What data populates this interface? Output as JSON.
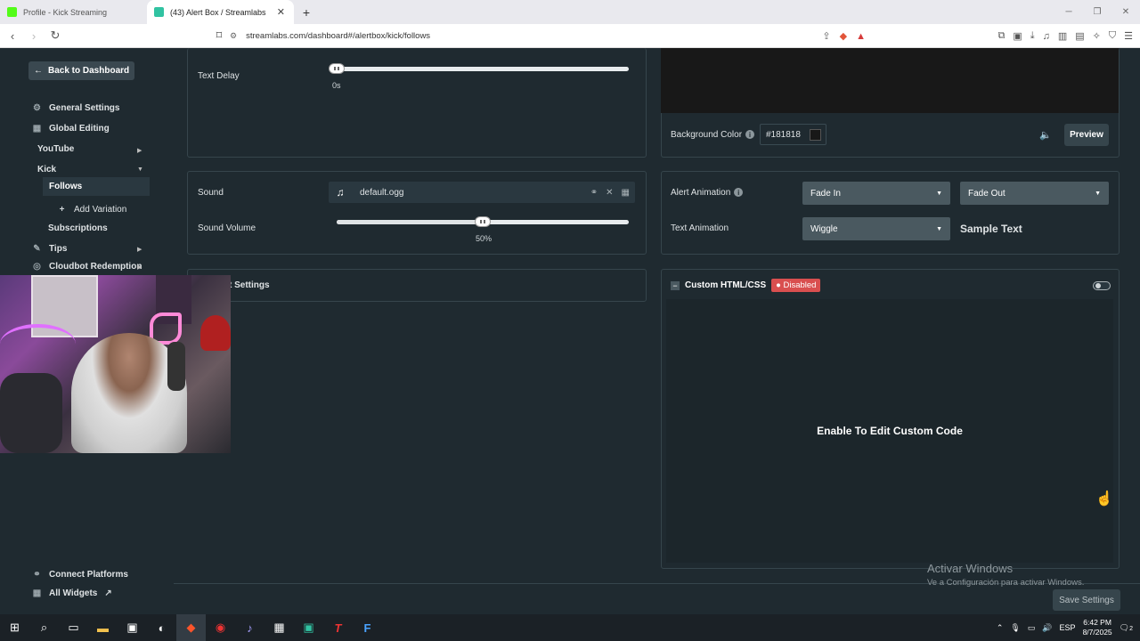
{
  "browser": {
    "tabs": [
      {
        "title": "Profile - Kick Streaming",
        "favicon_color": "#53fc18"
      },
      {
        "title": "(43) Alert Box / Streamlabs",
        "favicon_color": "#31c3a2"
      }
    ],
    "url": "streamlabs.com/dashboard#/alertbox/kick/follows"
  },
  "sidebar": {
    "back_label": "Back to Dashboard",
    "general_settings": "General Settings",
    "global_editing": "Global Editing",
    "youtube": "YouTube",
    "kick": "Kick",
    "follows": "Follows",
    "add_variation": "Add Variation",
    "subscriptions": "Subscriptions",
    "tips": "Tips",
    "cloudbot": "Cloudbot Redemption",
    "connect_platforms": "Connect Platforms",
    "all_widgets": "All Widgets"
  },
  "left_panel": {
    "text_delay_label": "Text Delay",
    "text_delay_value": "0s",
    "text_delay_fraction": 0,
    "sound_label": "Sound",
    "sound_file": "default.ogg",
    "sound_volume_label": "Sound Volume",
    "sound_volume_value": "50%",
    "sound_volume_fraction": 0.5,
    "settings_partial": "t Settings"
  },
  "right_panel": {
    "bg_color_label": "Background Color",
    "bg_color_value": "#181818",
    "preview_label": "Preview",
    "alert_animation_label": "Alert Animation",
    "alert_in": "Fade In",
    "alert_out": "Fade Out",
    "text_animation_label": "Text Animation",
    "text_anim": "Wiggle",
    "sample_text": "Sample Text",
    "custom_title": "Custom HTML/CSS",
    "custom_badge": "Disabled",
    "custom_message": "Enable To Edit Custom Code"
  },
  "footer": {
    "activate_title": "Activar Windows",
    "activate_sub": "Ve a Configuración para activar Windows.",
    "save_label": "Save Settings"
  },
  "taskbar": {
    "lang": "ESP",
    "time": "6:42 PM",
    "date": "8/7/2025",
    "notifications": "2"
  }
}
